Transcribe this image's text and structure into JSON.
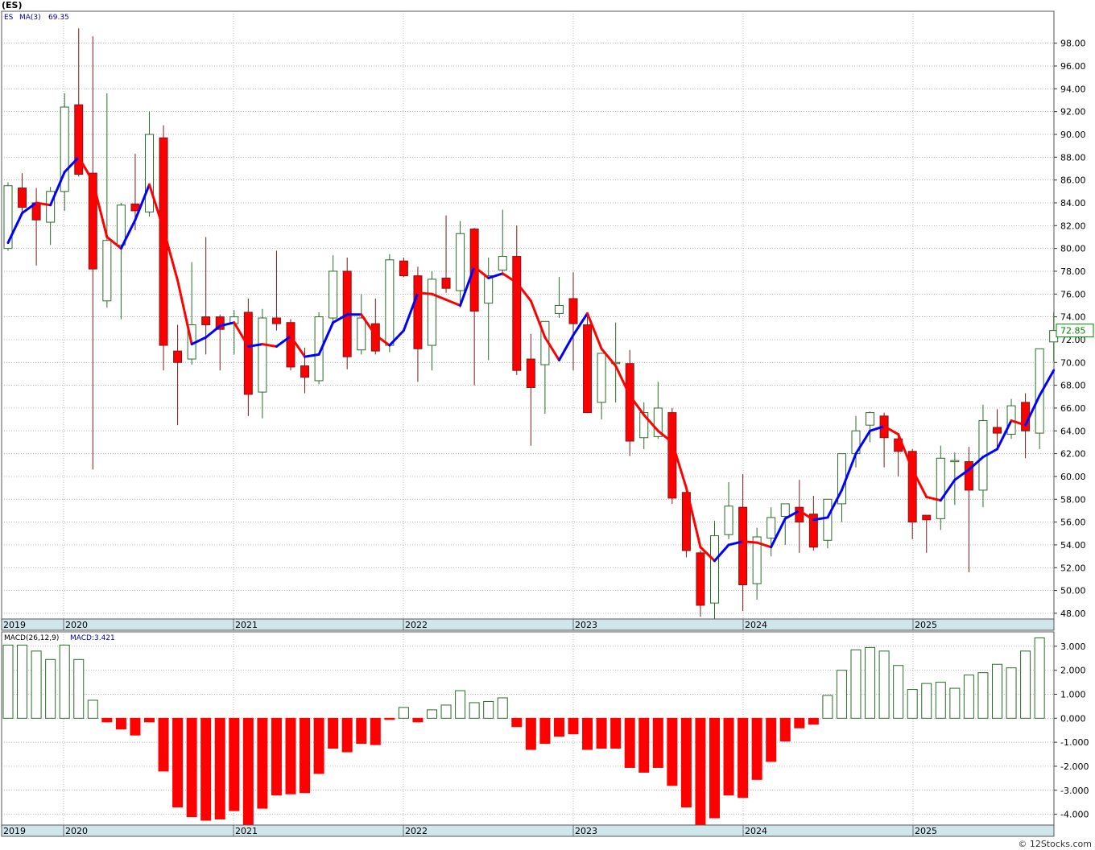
{
  "header": {
    "title": "(ES)"
  },
  "watermark": "© 12Stocks.com",
  "price_legend": {
    "symbol": "ES",
    "ma_label": "MA(3)",
    "ma_value": "69.35"
  },
  "macd_legend": {
    "label": "MACD(26,12,9)",
    "value_label": "MACD:3.421"
  },
  "last_price_label": "72.85",
  "colors": {
    "up": "#2b6b2b",
    "down": "#ff0000",
    "down_border": "#7a1a1a",
    "ma_up": "#0000ff",
    "ma_down": "#ff0000",
    "grid": "#999999",
    "axis_band": "#cfe6ec",
    "last_price_box": "#008000"
  },
  "chart_data": [
    {
      "type": "candlestick",
      "title": "(ES)",
      "ylim": [
        47.5,
        100.8
      ],
      "y_ticks": [
        "98.00",
        "96.00",
        "94.00",
        "92.00",
        "90.00",
        "88.00",
        "86.00",
        "84.00",
        "82.00",
        "80.00",
        "78.00",
        "76.00",
        "74.00",
        "72.00",
        "70.00",
        "68.00",
        "66.00",
        "64.00",
        "62.00",
        "60.00",
        "58.00",
        "56.00",
        "54.00",
        "52.00",
        "50.00",
        "48.00"
      ],
      "x_labels": [
        "2019",
        "2020",
        "2021",
        "2022",
        "2023",
        "2024",
        "2025"
      ],
      "grid": true,
      "series": [
        {
          "name": "ES",
          "candles": [
            {
              "o": 80.0,
              "h": 85.8,
              "l": 79.8,
              "c": 85.5
            },
            {
              "o": 85.3,
              "h": 86.6,
              "l": 83.2,
              "c": 83.6
            },
            {
              "o": 84.0,
              "h": 85.3,
              "l": 78.5,
              "c": 82.5
            },
            {
              "o": 82.3,
              "h": 85.4,
              "l": 80.3,
              "c": 85.0
            },
            {
              "o": 85.0,
              "h": 93.6,
              "l": 83.3,
              "c": 92.4
            },
            {
              "o": 92.6,
              "h": 99.3,
              "l": 86.3,
              "c": 86.5
            },
            {
              "o": 86.6,
              "h": 98.6,
              "l": 60.6,
              "c": 78.2
            },
            {
              "o": 75.4,
              "h": 93.6,
              "l": 74.8,
              "c": 80.7
            },
            {
              "o": 80.3,
              "h": 84.0,
              "l": 73.8,
              "c": 83.8
            },
            {
              "o": 83.9,
              "h": 88.3,
              "l": 81.6,
              "c": 83.3
            },
            {
              "o": 83.2,
              "h": 92.0,
              "l": 82.8,
              "c": 90.0
            },
            {
              "o": 89.7,
              "h": 90.8,
              "l": 69.3,
              "c": 71.5
            },
            {
              "o": 71.0,
              "h": 73.3,
              "l": 64.5,
              "c": 70.0
            },
            {
              "o": 70.3,
              "h": 78.8,
              "l": 69.8,
              "c": 73.3
            },
            {
              "o": 74.0,
              "h": 81.0,
              "l": 70.7,
              "c": 73.3
            },
            {
              "o": 74.0,
              "h": 74.2,
              "l": 69.3,
              "c": 72.9
            },
            {
              "o": 73.4,
              "h": 74.6,
              "l": 70.7,
              "c": 74.0
            },
            {
              "o": 74.4,
              "h": 75.6,
              "l": 65.3,
              "c": 67.2
            },
            {
              "o": 67.4,
              "h": 74.7,
              "l": 65.1,
              "c": 73.9
            },
            {
              "o": 73.9,
              "h": 79.8,
              "l": 72.8,
              "c": 73.4
            },
            {
              "o": 73.5,
              "h": 73.8,
              "l": 69.3,
              "c": 69.6
            },
            {
              "o": 69.7,
              "h": 71.3,
              "l": 67.3,
              "c": 68.7
            },
            {
              "o": 68.4,
              "h": 74.4,
              "l": 68.1,
              "c": 74.0
            },
            {
              "o": 73.9,
              "h": 79.4,
              "l": 73.5,
              "c": 78.0
            },
            {
              "o": 78.0,
              "h": 79.2,
              "l": 69.4,
              "c": 70.5
            },
            {
              "o": 71.1,
              "h": 76.0,
              "l": 70.7,
              "c": 73.9
            },
            {
              "o": 73.4,
              "h": 75.6,
              "l": 70.7,
              "c": 71.0
            },
            {
              "o": 71.5,
              "h": 79.5,
              "l": 70.9,
              "c": 79.0
            },
            {
              "o": 78.9,
              "h": 79.2,
              "l": 77.5,
              "c": 77.6
            },
            {
              "o": 77.6,
              "h": 78.4,
              "l": 68.3,
              "c": 71.2
            },
            {
              "o": 71.5,
              "h": 78.0,
              "l": 69.3,
              "c": 77.3
            },
            {
              "o": 77.4,
              "h": 82.9,
              "l": 76.1,
              "c": 76.5
            },
            {
              "o": 76.3,
              "h": 82.4,
              "l": 74.8,
              "c": 81.3
            },
            {
              "o": 81.7,
              "h": 81.8,
              "l": 68.0,
              "c": 74.5
            },
            {
              "o": 75.2,
              "h": 79.2,
              "l": 70.2,
              "c": 77.6
            },
            {
              "o": 78.1,
              "h": 83.4,
              "l": 77.6,
              "c": 79.3
            },
            {
              "o": 79.3,
              "h": 82.0,
              "l": 68.9,
              "c": 69.3
            },
            {
              "o": 70.3,
              "h": 72.5,
              "l": 62.7,
              "c": 67.8
            },
            {
              "o": 69.8,
              "h": 73.6,
              "l": 65.5,
              "c": 73.6
            },
            {
              "o": 74.3,
              "h": 77.5,
              "l": 73.9,
              "c": 75.0
            },
            {
              "o": 75.6,
              "h": 77.9,
              "l": 69.3,
              "c": 73.4
            },
            {
              "o": 73.3,
              "h": 74.2,
              "l": 65.6,
              "c": 65.6
            },
            {
              "o": 66.5,
              "h": 70.6,
              "l": 65.0,
              "c": 70.8
            },
            {
              "o": 70.0,
              "h": 73.5,
              "l": 66.5,
              "c": 70.0
            },
            {
              "o": 69.9,
              "h": 71.1,
              "l": 61.8,
              "c": 63.1
            },
            {
              "o": 63.4,
              "h": 66.5,
              "l": 62.4,
              "c": 65.6
            },
            {
              "o": 63.5,
              "h": 68.3,
              "l": 63.3,
              "c": 66.0
            },
            {
              "o": 65.6,
              "h": 66.0,
              "l": 57.6,
              "c": 58.1
            },
            {
              "o": 58.6,
              "h": 58.7,
              "l": 52.9,
              "c": 53.5
            },
            {
              "o": 53.3,
              "h": 53.5,
              "l": 47.7,
              "c": 48.7
            },
            {
              "o": 48.9,
              "h": 56.1,
              "l": 47.5,
              "c": 54.8
            },
            {
              "o": 54.9,
              "h": 59.5,
              "l": 54.5,
              "c": 57.4
            },
            {
              "o": 57.3,
              "h": 60.2,
              "l": 48.2,
              "c": 50.5
            },
            {
              "o": 50.6,
              "h": 55.5,
              "l": 49.2,
              "c": 54.7
            },
            {
              "o": 54.6,
              "h": 57.3,
              "l": 53.0,
              "c": 56.4
            },
            {
              "o": 56.5,
              "h": 57.4,
              "l": 54.0,
              "c": 57.6
            },
            {
              "o": 57.3,
              "h": 59.7,
              "l": 53.3,
              "c": 56.0
            },
            {
              "o": 56.7,
              "h": 58.3,
              "l": 53.5,
              "c": 53.8
            },
            {
              "o": 54.4,
              "h": 57.6,
              "l": 53.7,
              "c": 58.0
            },
            {
              "o": 57.6,
              "h": 62.0,
              "l": 56.0,
              "c": 62.0
            },
            {
              "o": 62.0,
              "h": 65.3,
              "l": 60.8,
              "c": 64.0
            },
            {
              "o": 64.5,
              "h": 65.7,
              "l": 63.0,
              "c": 65.6
            },
            {
              "o": 65.3,
              "h": 65.6,
              "l": 60.8,
              "c": 63.4
            },
            {
              "o": 63.3,
              "h": 63.7,
              "l": 60.0,
              "c": 62.2
            },
            {
              "o": 62.2,
              "h": 62.4,
              "l": 54.5,
              "c": 56.0
            },
            {
              "o": 56.6,
              "h": 56.6,
              "l": 53.3,
              "c": 56.2
            },
            {
              "o": 56.3,
              "h": 62.7,
              "l": 55.3,
              "c": 61.6
            },
            {
              "o": 61.3,
              "h": 62.1,
              "l": 57.5,
              "c": 61.4
            },
            {
              "o": 61.3,
              "h": 62.6,
              "l": 51.6,
              "c": 58.8
            },
            {
              "o": 58.8,
              "h": 66.3,
              "l": 57.3,
              "c": 64.9
            },
            {
              "o": 64.3,
              "h": 65.9,
              "l": 62.3,
              "c": 63.8
            },
            {
              "o": 63.7,
              "h": 66.8,
              "l": 63.3,
              "c": 66.2
            },
            {
              "o": 66.5,
              "h": 67.3,
              "l": 61.6,
              "c": 64.0
            },
            {
              "o": 63.8,
              "h": 71.2,
              "l": 62.4,
              "c": 71.2
            },
            {
              "o": 71.8,
              "h": 74.4,
              "l": 70.1,
              "c": 72.8
            }
          ]
        },
        {
          "name": "MA(3)",
          "values": [
            80.5,
            83.1,
            84.0,
            83.8,
            86.7,
            88.0,
            85.9,
            81.0,
            80.0,
            82.5,
            85.6,
            81.7,
            77.2,
            71.6,
            72.2,
            73.2,
            73.5,
            71.4,
            71.6,
            71.4,
            72.3,
            70.5,
            70.7,
            73.5,
            74.2,
            74.2,
            72.4,
            71.5,
            72.8,
            76.1,
            76.0,
            75.5,
            75.0,
            78.4,
            77.4,
            77.8,
            77.0,
            75.4,
            72.2,
            70.2,
            72.4,
            74.3,
            71.2,
            69.7,
            67.1,
            65.4,
            64.0,
            63.0,
            59.0,
            53.8,
            52.6,
            54.0,
            54.3,
            54.2,
            53.8,
            56.3,
            57.0,
            56.2,
            56.4,
            58.8,
            62.0,
            64.0,
            64.4,
            63.7,
            60.6,
            58.2,
            57.9,
            59.7,
            60.6,
            61.7,
            62.4,
            64.9,
            64.5,
            67.1,
            69.3
          ]
        }
      ]
    },
    {
      "type": "bar",
      "title": "MACD(26,12,9)",
      "ylim": [
        -4.45,
        3.6
      ],
      "y_ticks": [
        "3.000",
        "2.000",
        "1.000",
        "0.000",
        "-1.000",
        "-2.000",
        "-3.000",
        "-4.000"
      ],
      "x_labels": [
        "2019",
        "2020",
        "2021",
        "2022",
        "2023",
        "2024",
        "2025"
      ],
      "grid": true,
      "series": [
        {
          "name": "MACD",
          "values": [
            3.05,
            3.05,
            2.8,
            2.45,
            3.05,
            2.45,
            0.75,
            -0.15,
            -0.45,
            -0.7,
            -0.15,
            -2.2,
            -3.7,
            -4.1,
            -4.25,
            -4.2,
            -3.85,
            -4.45,
            -3.75,
            -3.2,
            -3.15,
            -3.1,
            -2.3,
            -1.25,
            -1.4,
            -1.05,
            -1.1,
            -0.05,
            0.45,
            -0.15,
            0.35,
            0.55,
            1.15,
            0.65,
            0.7,
            0.85,
            -0.35,
            -1.3,
            -1.05,
            -0.75,
            -0.65,
            -1.3,
            -1.25,
            -1.25,
            -2.05,
            -2.25,
            -2.05,
            -2.8,
            -3.7,
            -4.45,
            -4.15,
            -3.2,
            -3.3,
            -2.55,
            -1.8,
            -0.95,
            -0.4,
            -0.25,
            0.95,
            2.0,
            2.85,
            2.95,
            2.8,
            2.2,
            1.2,
            1.45,
            1.5,
            1.25,
            1.8,
            1.9,
            2.25,
            2.1,
            2.8,
            3.35
          ]
        }
      ]
    }
  ]
}
